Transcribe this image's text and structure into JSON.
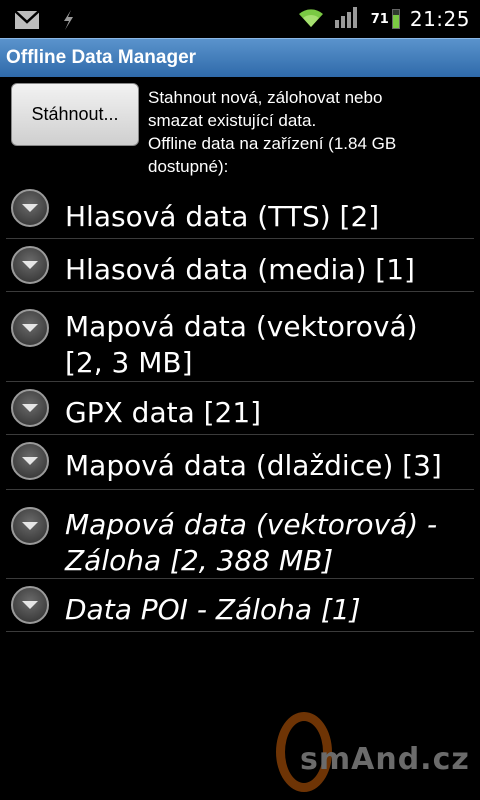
{
  "status_bar": {
    "time": "21:25",
    "battery_level": "71",
    "icons": [
      "gmail-icon",
      "usb-debug-icon",
      "wifi-icon",
      "signal-icon",
      "battery-icon"
    ]
  },
  "title": "Offline Data Manager",
  "download_button": "Stáhnout...",
  "header_text": [
    "Stahnout nová, zálohovat nebo",
    "smazat existující data.",
    "Offline data na zařízení (1.84 GB",
    "dostupné):"
  ],
  "items": [
    {
      "line1": "Hlasová data (TTS)  [2]",
      "line2": ""
    },
    {
      "line1": "Hlasová data (media)  [1]",
      "line2": ""
    },
    {
      "line1": "Mapová data (vektorová)",
      "line2": "[2, 3 MB]"
    },
    {
      "line1": "GPX data  [21]",
      "line2": ""
    },
    {
      "line1": "Mapová data (dlaždice)  [3]",
      "line2": ""
    },
    {
      "line1": "Mapová data (vektorová) -",
      "line2": "Záloha  [2, 388 MB]"
    },
    {
      "line1": "Data POI - Záloha  [1]",
      "line2": ""
    }
  ],
  "watermark": "smAnd.cz",
  "colors": {
    "title_bar": "#3d7bbd",
    "background": "#000000",
    "battery": "#7ac943",
    "watermark_o": "#7a3a06"
  }
}
